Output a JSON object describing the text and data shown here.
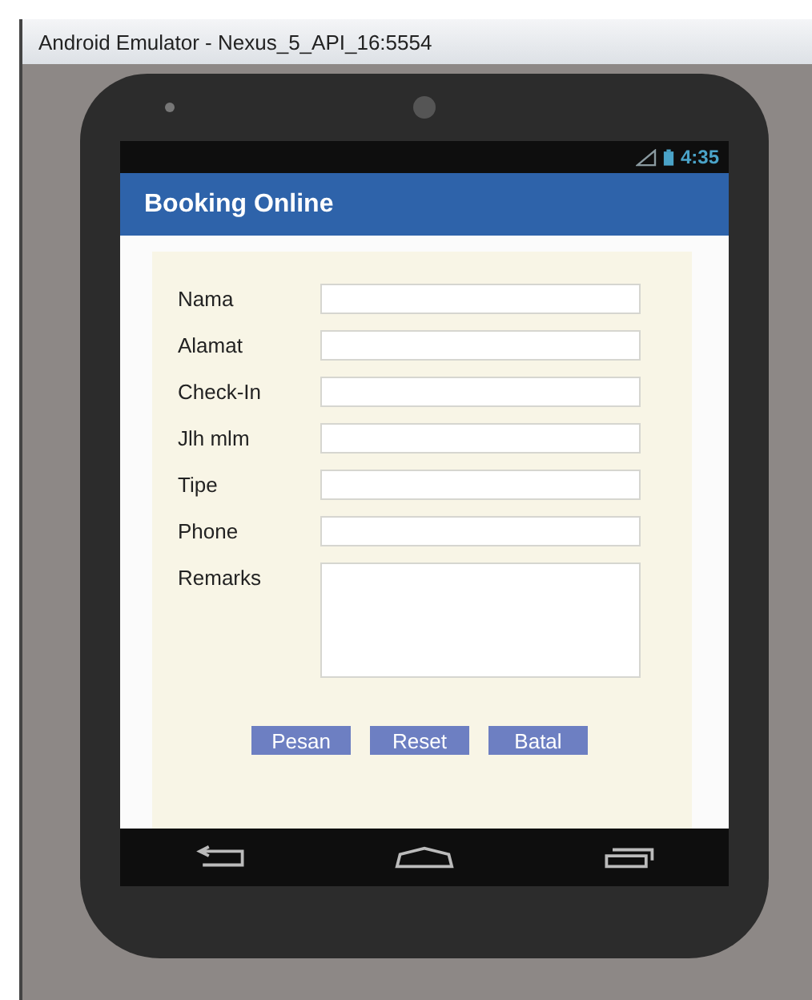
{
  "window": {
    "title": "Android Emulator - Nexus_5_API_16:5554"
  },
  "status_bar": {
    "time": "4:35"
  },
  "app_bar": {
    "title": "Booking Online"
  },
  "form": {
    "fields": [
      {
        "label": "Nama",
        "kind": "line"
      },
      {
        "label": "Alamat",
        "kind": "line"
      },
      {
        "label": "Check-In",
        "kind": "line"
      },
      {
        "label": "Jlh mlm",
        "kind": "line"
      },
      {
        "label": "Tipe",
        "kind": "line"
      },
      {
        "label": "Phone",
        "kind": "line"
      },
      {
        "label": "Remarks",
        "kind": "area"
      }
    ],
    "buttons": [
      "Pesan",
      "Reset",
      "Batal"
    ]
  }
}
